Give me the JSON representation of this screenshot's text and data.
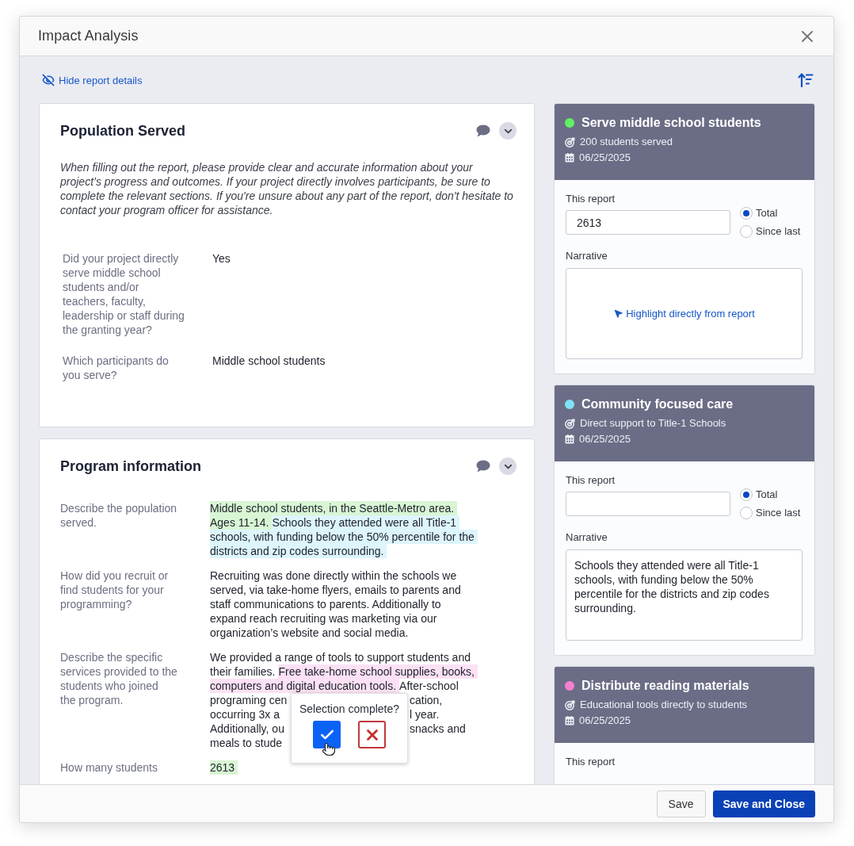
{
  "dialog": {
    "title": "Impact Analysis",
    "toggle_link": "Hide report details"
  },
  "sections": [
    {
      "title": "Population Served",
      "intro": "When filling out the report, please provide clear and accurate information about your\nproject’s progress and outcomes. If your project directly involves participants, be sure to\ncomplete the relevant sections. If you're unsure about any part of the report, don't hesitate to\ncontact your program officer for assistance.",
      "rows": [
        {
          "question": "Did your project directly\nserve middle school\nstudents and/or\nteachers, faculty,\nleadership or staff during\nthe granting year?",
          "answer": "Yes"
        },
        {
          "question": "Which participants do\nyou serve?",
          "answer": "Middle school students"
        }
      ]
    },
    {
      "title": "Program information",
      "rows": [
        {
          "question": "Describe the population\nserved.",
          "lines": [
            {
              "kind": "full",
              "segments": [
                {
                  "text": "Middle school students, in the Seattle-Metro area.",
                  "color": "#d8f6d4"
                }
              ]
            },
            {
              "kind": "full",
              "segments": [
                {
                  "text": "Ages 11-14.",
                  "color": "#d8f6d4"
                },
                {
                  "text": "Schools they attended were all Title-1",
                  "color": "#ddf5fc"
                }
              ]
            },
            {
              "kind": "full",
              "segments": [
                {
                  "text": "schools, with funding below the 50% percentile for the",
                  "color": "#ddf5fc"
                }
              ]
            },
            {
              "kind": "full",
              "segments": [
                {
                  "text": "districts and zip codes surrounding.",
                  "color": "#ddf5fc"
                }
              ]
            }
          ]
        },
        {
          "question": "How did you recruit or\nfind students for your\nprogramming?",
          "lines": [
            {
              "kind": "full",
              "segments": [
                {
                  "text": "Recruiting was done directly within the schools we"
                }
              ]
            },
            {
              "kind": "full",
              "segments": [
                {
                  "text": "served, via take-home flyers, emails to parents and"
                }
              ]
            },
            {
              "kind": "full",
              "segments": [
                {
                  "text": "staff communications to parents. Additionally to"
                }
              ]
            },
            {
              "kind": "full",
              "segments": [
                {
                  "text": "expand reach recruiting was marketing via our"
                }
              ]
            },
            {
              "kind": "full",
              "segments": [
                {
                  "text": "organization’s website and social media."
                }
              ]
            }
          ]
        },
        {
          "question": "Describe the specific\nservices provided to the\nstudents who joined\nthe program.",
          "lines": [
            {
              "kind": "full",
              "segments": [
                {
                  "text": "We provided a range of tools to support students and"
                }
              ]
            },
            {
              "kind": "full",
              "segments": [
                {
                  "text": "their families."
                },
                {
                  "text": "Free take-home school supplies, books,",
                  "color": "#fce1f4"
                }
              ]
            },
            {
              "kind": "full",
              "segments": [
                {
                  "text": "computers and digital education tools.",
                  "color": "#fce1f4"
                },
                {
                  "text": "After-school"
                }
              ]
            },
            {
              "kind": "split",
              "left": "programing cen",
              "right": "cation,"
            },
            {
              "kind": "split",
              "left": "occurring 3x a",
              "right": "l year."
            },
            {
              "kind": "split",
              "left": "Additionally, ou",
              "right": "snacks and"
            },
            {
              "kind": "split",
              "left": "meals to stude"
            }
          ],
          "popover": {
            "question": "Selection complete?"
          }
        },
        {
          "question": "How many students",
          "lines": [
            {
              "kind": "full",
              "segments": [
                {
                  "text": "2613",
                  "color": "#d8f6d4"
                }
              ]
            }
          ]
        }
      ]
    }
  ],
  "goals": [
    {
      "title": "Serve middle school students",
      "color": "#62f063",
      "target": "200 students served",
      "date": "06/25/2025",
      "report_label": "This report",
      "report_value": "2613",
      "options": [
        {
          "label": "Total",
          "selected": true
        },
        {
          "label": "Since last",
          "selected": false
        }
      ],
      "narrative_label": "Narrative",
      "narrative_action": "Highlight directly from report"
    },
    {
      "title": "Community focused care",
      "color": "#80e3f7",
      "target": "Direct support to Title-1 Schools",
      "date": "06/25/2025",
      "report_label": "This report",
      "options": [
        {
          "label": "Total",
          "selected": true
        },
        {
          "label": "Since last",
          "selected": false
        }
      ],
      "narrative_label": "Narrative",
      "narrative": "Schools they attended were all Title-1 schools, with funding below the 50% percentile for the districts and zip codes surrounding."
    },
    {
      "title": "Distribute reading materials",
      "color": "#f77fd2",
      "target": "Educational tools directly to students",
      "date": "06/25/2025",
      "report_label": "This report"
    }
  ],
  "footer": {
    "buttons": [
      {
        "label": "Save",
        "kind": "secondary"
      },
      {
        "label": "Save and Close",
        "kind": "primary"
      }
    ]
  }
}
